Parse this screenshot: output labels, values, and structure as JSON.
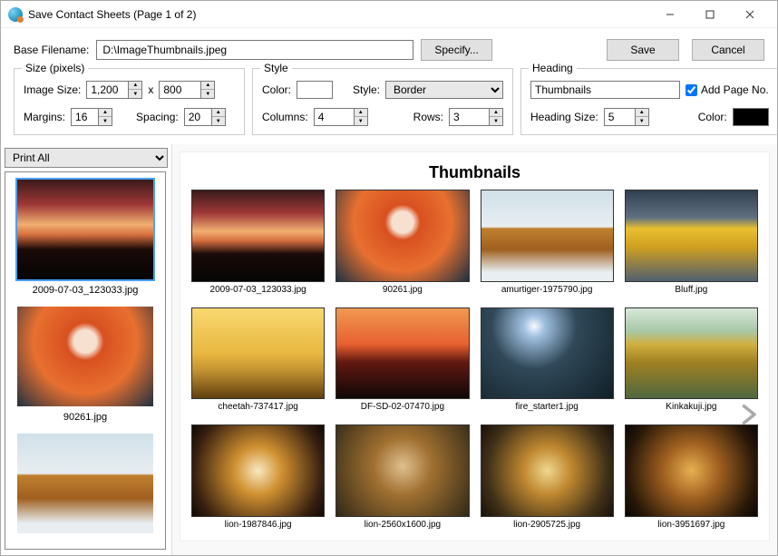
{
  "window_title": "Save Contact Sheets (Page 1 of 2)",
  "filename": {
    "label": "Base Filename:",
    "value": "D:\\ImageThumbnails.jpeg",
    "specify_btn": "Specify...",
    "save_btn": "Save",
    "cancel_btn": "Cancel"
  },
  "size_group": {
    "legend": "Size (pixels)",
    "image_size_label": "Image Size:",
    "width": "1,200",
    "x": "x",
    "height": "800",
    "margins_label": "Margins:",
    "margins": "16",
    "spacing_label": "Spacing:",
    "spacing": "20"
  },
  "style_group": {
    "legend": "Style",
    "color_label": "Color:",
    "style_label": "Style:",
    "style_value": "Border",
    "columns_label": "Columns:",
    "columns": "4",
    "rows_label": "Rows:",
    "rows": "3"
  },
  "heading_group": {
    "legend": "Heading",
    "heading_value": "Thumbnails",
    "add_page_no_label": "Add Page No.",
    "add_page_no_checked": true,
    "heading_size_label": "Heading Size:",
    "heading_size": "5",
    "color_label": "Color:"
  },
  "print_dropdown": "Print All",
  "sidebar_items": [
    {
      "caption": "2009-07-03_123033.jpg",
      "img": "img-fireworks",
      "selected": true
    },
    {
      "caption": "90261.jpg",
      "img": "img-redhead",
      "selected": false
    },
    {
      "caption": "",
      "img": "img-tiger",
      "selected": false
    }
  ],
  "sheet_title": "Thumbnails",
  "grid_items": [
    {
      "caption": "2009-07-03_123033.jpg",
      "img": "img-fireworks"
    },
    {
      "caption": "90261.jpg",
      "img": "img-redhead"
    },
    {
      "caption": "amurtiger-1975790.jpg",
      "img": "img-tiger"
    },
    {
      "caption": "Bluff.jpg",
      "img": "img-bluff"
    },
    {
      "caption": "cheetah-737417.jpg",
      "img": "img-cheetah"
    },
    {
      "caption": "DF-SD-02-07470.jpg",
      "img": "img-joshua"
    },
    {
      "caption": "fire_starter1.jpg",
      "img": "img-lightning"
    },
    {
      "caption": "Kinkakuji.jpg",
      "img": "img-kinkakuji"
    },
    {
      "caption": "lion-1987846.jpg",
      "img": "img-lion1"
    },
    {
      "caption": "lion-2560x1600.jpg",
      "img": "img-lion2"
    },
    {
      "caption": "lion-2905725.jpg",
      "img": "img-lion3"
    },
    {
      "caption": "lion-3951697.jpg",
      "img": "img-lion4"
    }
  ]
}
